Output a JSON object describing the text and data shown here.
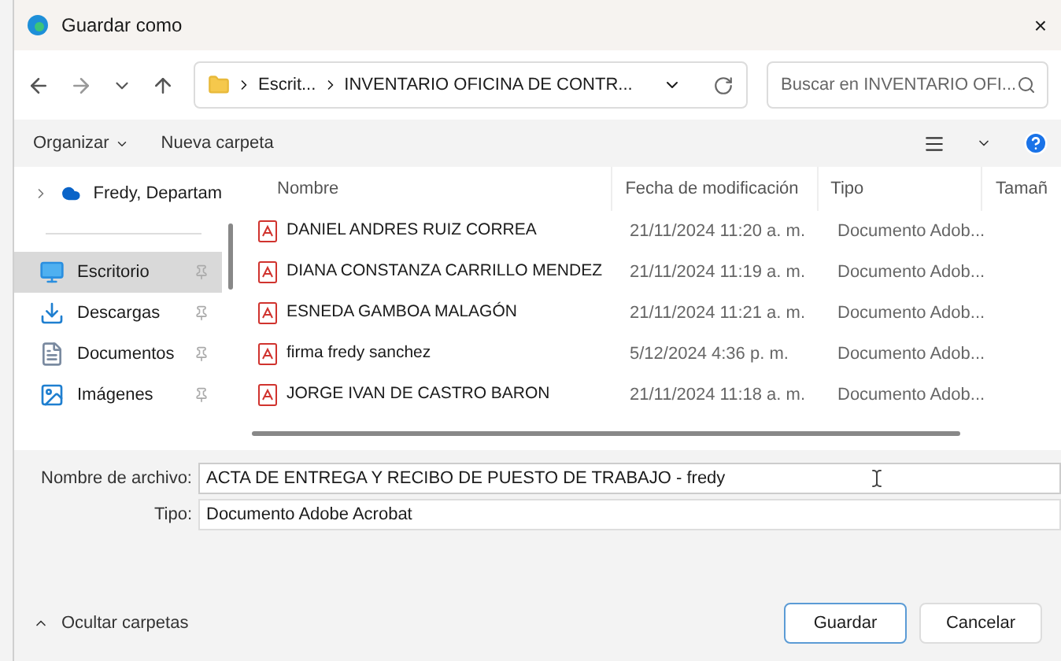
{
  "window": {
    "title": "Guardar como",
    "close": "×"
  },
  "address": {
    "crumbs": [
      "Escrit...",
      "INVENTARIO OFICINA DE CONTR..."
    ],
    "search_placeholder": "Buscar en INVENTARIO OFI..."
  },
  "toolbar": {
    "organize": "Organizar",
    "new_folder": "Nueva carpeta"
  },
  "sidebar": {
    "items": [
      {
        "kind": "cloud",
        "label": "Fredy, Departam",
        "selected": false
      },
      {
        "kind": "desktop",
        "label": "Escritorio",
        "selected": true
      },
      {
        "kind": "downloads",
        "label": "Descargas",
        "selected": false
      },
      {
        "kind": "documents",
        "label": "Documentos",
        "selected": false
      },
      {
        "kind": "pictures",
        "label": "Imágenes",
        "selected": false
      }
    ]
  },
  "table": {
    "columns": [
      "Nombre",
      "Fecha de modificación",
      "Tipo",
      "Tamañ"
    ],
    "rows": [
      {
        "name": "DANIEL ANDRES RUIZ CORREA",
        "date": "21/11/2024 11:20 a. m.",
        "type": "Documento Adob..."
      },
      {
        "name": "DIANA CONSTANZA CARRILLO MENDEZ",
        "date": "21/11/2024 11:19 a. m.",
        "type": "Documento Adob..."
      },
      {
        "name": "ESNEDA GAMBOA MALAGÓN",
        "date": "21/11/2024 11:21 a. m.",
        "type": "Documento Adob..."
      },
      {
        "name": "firma fredy sanchez",
        "date": "5/12/2024 4:36 p. m.",
        "type": "Documento Adob..."
      },
      {
        "name": "JORGE IVAN DE CASTRO BARON",
        "date": "21/11/2024 11:18 a. m.",
        "type": "Documento Adob..."
      }
    ]
  },
  "form": {
    "filename_label": "Nombre de archivo:",
    "filename": "ACTA DE ENTREGA Y RECIBO DE PUESTO DE TRABAJO - fredy",
    "type_label": "Tipo:",
    "type": "Documento Adobe Acrobat"
  },
  "footer": {
    "toggle": "Ocultar carpetas",
    "buttons": [
      "Guardar",
      "Cancelar"
    ]
  }
}
